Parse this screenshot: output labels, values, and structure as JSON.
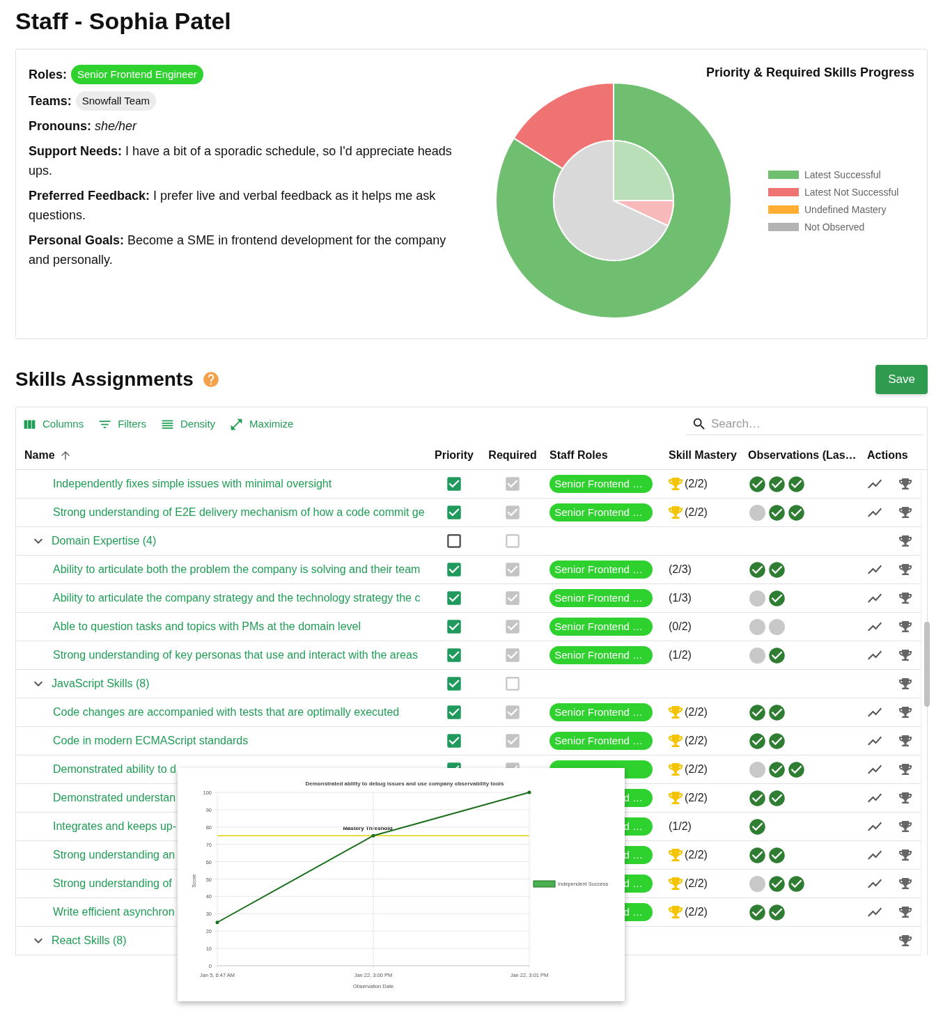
{
  "page_title": "Staff - Sophia Patel",
  "profile": {
    "roles_label": "Roles:",
    "roles": [
      "Senior Frontend Engineer"
    ],
    "teams_label": "Teams:",
    "teams": [
      "Snowfall Team"
    ],
    "details": [
      {
        "label": "Pronouns:",
        "value": "she/her",
        "italic": true
      },
      {
        "label": "Support Needs:",
        "value": "I have a bit of a sporadic schedule, so I'd appreciate heads ups.",
        "italic": false
      },
      {
        "label": "Preferred Feedback:",
        "value": "I prefer live and verbal feedback as it helps me ask questions.",
        "italic": false
      },
      {
        "label": "Personal Goals:",
        "value": "Become a SME in frontend development for the company and personally.",
        "italic": false
      }
    ]
  },
  "progress_chart": {
    "title": "Priority & Required Skills Progress",
    "legend": [
      {
        "label": "Latest Successful",
        "color": "#70bf70"
      },
      {
        "label": "Latest Not Successful",
        "color": "#ef7373"
      },
      {
        "label": "Undefined Mastery",
        "color": "#ffad33"
      },
      {
        "label": "Not Observed",
        "color": "#b3b3b3"
      }
    ]
  },
  "skills": {
    "title": "Skills Assignments",
    "save_label": "Save",
    "toolbar": [
      {
        "kind": "columns",
        "label": "Columns"
      },
      {
        "kind": "filters",
        "label": "Filters"
      },
      {
        "kind": "density",
        "label": "Density"
      },
      {
        "kind": "maximize",
        "label": "Maximize"
      }
    ],
    "search": {
      "placeholder": "Search…"
    },
    "columns": [
      {
        "label": "Name",
        "sorted_ascending": true
      },
      {
        "label": "Priority"
      },
      {
        "label": "Required"
      },
      {
        "label": "Staff Roles"
      },
      {
        "label": "Skill Mastery"
      },
      {
        "label": "Observations (Las…"
      },
      {
        "label": "Actions"
      }
    ],
    "rows": [
      {
        "kind": "skill",
        "name": "Independently fixes simple issues with minimal oversight",
        "priority": true,
        "required": true,
        "role_chip": true,
        "role": "Senior Frontend …",
        "trophy": true,
        "mastery": "(2/2)",
        "observations": [
          {
            "success": true
          },
          {
            "success": true
          },
          {
            "success": true
          }
        ]
      },
      {
        "kind": "skill",
        "name": "Strong understanding of E2E delivery mechanism of how a code commit ge",
        "priority": true,
        "required": true,
        "role_chip": true,
        "role": "Senior Frontend …",
        "trophy": true,
        "mastery": "(2/2)",
        "observations": [
          {
            "success": false
          },
          {
            "success": true
          },
          {
            "success": true
          }
        ]
      },
      {
        "kind": "group",
        "name": "Domain Expertise (4)",
        "expanded": true,
        "priority": false,
        "required": false,
        "children": [
          {
            "kind": "skill",
            "name": "Ability to articulate both the problem the company is solving and their team",
            "priority": true,
            "required": true,
            "role_chip": true,
            "role": "Senior Frontend …",
            "trophy": false,
            "mastery": "(2/3)",
            "observations": [
              {
                "success": true
              },
              {
                "success": true
              }
            ]
          },
          {
            "kind": "skill",
            "name": "Ability to articulate the company strategy and the technology strategy the c",
            "priority": true,
            "required": true,
            "role_chip": true,
            "role": "Senior Frontend …",
            "trophy": false,
            "mastery": "(1/3)",
            "observations": [
              {
                "success": false
              },
              {
                "success": true
              }
            ]
          },
          {
            "kind": "skill",
            "name": "Able to question tasks and topics with PMs at the domain level",
            "priority": true,
            "required": true,
            "role_chip": true,
            "role": "Senior Frontend …",
            "trophy": false,
            "mastery": "(0/2)",
            "observations": [
              {
                "success": false
              },
              {
                "success": false
              }
            ]
          },
          {
            "kind": "skill",
            "name": "Strong understanding of key personas that use and interact with the areas",
            "priority": true,
            "required": true,
            "role_chip": true,
            "role": "Senior Frontend …",
            "trophy": false,
            "mastery": "(1/2)",
            "observations": [
              {
                "success": false
              },
              {
                "success": true
              }
            ]
          }
        ]
      },
      {
        "kind": "group",
        "name": "JavaScript Skills (8)",
        "expanded": true,
        "priority": true,
        "required": false,
        "children": [
          {
            "kind": "skill",
            "name": "Code changes are accompanied with tests that are optimally executed",
            "priority": true,
            "required": true,
            "role_chip": true,
            "role": "Senior Frontend …",
            "trophy": true,
            "mastery": "(2/2)",
            "observations": [
              {
                "success": true
              },
              {
                "success": true
              }
            ]
          },
          {
            "kind": "skill",
            "name": "Code in modern ECMAScript standards",
            "priority": true,
            "required": true,
            "role_chip": true,
            "role": "Senior Frontend …",
            "trophy": true,
            "mastery": "(2/2)",
            "observations": [
              {
                "success": true
              },
              {
                "success": true
              }
            ]
          },
          {
            "kind": "skill",
            "name": "Demonstrated ability to d",
            "priority": true,
            "required": true,
            "role_chip": true,
            "trophy": true,
            "mastery": "(2/2)",
            "observations": [
              {
                "success": false
              },
              {
                "success": true
              },
              {
                "success": true
              }
            ]
          },
          {
            "kind": "skill",
            "name": "Demonstrated understan",
            "role_chip": true,
            "role": "d …",
            "trophy": true,
            "mastery": "(2/2)",
            "observations": [
              {
                "success": true
              },
              {
                "success": true
              }
            ]
          },
          {
            "kind": "skill",
            "name": "Integrates and keeps up-",
            "role_chip": true,
            "role": "d …",
            "trophy": false,
            "mastery": "(1/2)",
            "observations": [
              {
                "success": true
              }
            ]
          },
          {
            "kind": "skill",
            "name": "Strong understanding an",
            "role_chip": true,
            "role": "d …",
            "trophy": true,
            "mastery": "(2/2)",
            "observations": [
              {
                "success": true
              },
              {
                "success": true
              }
            ]
          },
          {
            "kind": "skill",
            "name": "Strong understanding of",
            "role_chip": true,
            "role": "d …",
            "trophy": true,
            "mastery": "(2/2)",
            "observations": [
              {
                "success": false
              },
              {
                "success": true
              },
              {
                "success": true
              }
            ]
          },
          {
            "kind": "skill",
            "name": "Write efficient asynchron",
            "role_chip": true,
            "role": "d …",
            "trophy": true,
            "mastery": "(2/2)",
            "observations": [
              {
                "success": true
              },
              {
                "success": true
              }
            ]
          }
        ]
      },
      {
        "kind": "group",
        "name": "React Skills (8)",
        "expanded": true
      }
    ],
    "detail_chart": {
      "chart_data": {
        "type": "line",
        "title": "Demonstrated ability to debug issues and use company observability tools",
        "xlabel": "Observation Date",
        "ylabel": "Score",
        "categories": [
          "Jan 5, 6:47 AM",
          "Jan 22, 3:00 PM",
          "Jan 22, 3:01 PM"
        ],
        "series": [
          {
            "name": "Independent Success",
            "color": "#1b6e1b",
            "values": [
              25,
              75,
              100
            ]
          }
        ],
        "ylim": [
          0,
          100
        ],
        "yticks": [
          0,
          10,
          20,
          30,
          40,
          50,
          60,
          70,
          80,
          90,
          100
        ],
        "grid": true,
        "ref_lines": [
          {
            "axis": "y",
            "value": 75,
            "label": "Mastery Threshold",
            "color": "#e6d200"
          }
        ]
      }
    }
  }
}
